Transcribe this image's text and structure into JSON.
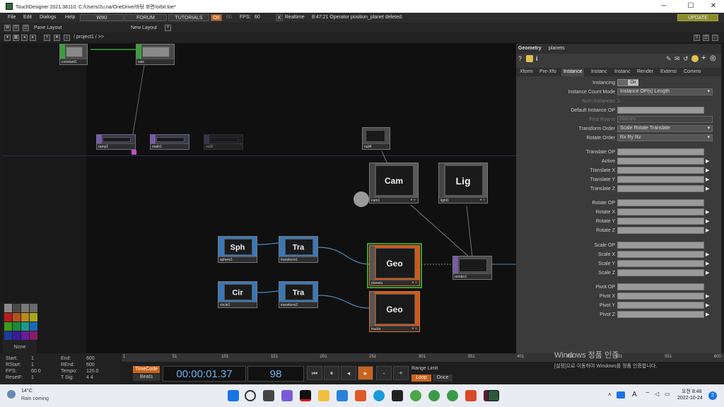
{
  "window": {
    "title": "TouchDesigner 2021.38110: C:/Users/2u.na/OneDrive/바탕 화면/orbit.toe*",
    "minimize": "─",
    "maximize": "☐",
    "close": "✕"
  },
  "menu": {
    "items": [
      "File",
      "Edit",
      "Dialogs",
      "Help"
    ],
    "wiki": "WIKI",
    "forum": "FORUM",
    "tutorials": "TUTORIALS",
    "oii": "OII",
    "fps_target": "60",
    "fps_label": "FPS:",
    "fps_value": "60",
    "x": "X",
    "realtime": "Realtime",
    "message": "8:47:21 Operator position_planet deleted.",
    "update": "UPDATE"
  },
  "layout": {
    "pane_layout": "Pane Layout",
    "new_layout": "New Layout",
    "plus": "+"
  },
  "path": {
    "text": "/ project1 / >>",
    "zero": "0"
  },
  "operators": {
    "constant1": "constant1",
    "vals": "vals",
    "ramp1": "ramp1",
    "math1": "math1",
    "null2": "null2",
    "null4": "null4",
    "cam": {
      "label": "Cam",
      "name": "cam1"
    },
    "light": {
      "label": "Lig",
      "name": "light1"
    },
    "sphere": {
      "label": "Sph",
      "name": "sphere1"
    },
    "tra1": {
      "label": "Tra",
      "name": "transform1"
    },
    "circle": {
      "label": "Cir",
      "name": "circle1"
    },
    "tra2": {
      "label": "Tra",
      "name": "transform2"
    },
    "geo1": {
      "label": "Geo",
      "name": "planets"
    },
    "geo2": {
      "label": "Geo",
      "name": "tracks"
    },
    "render": {
      "name": "render1"
    }
  },
  "palette": {
    "none": "None",
    "colors": [
      "#8a8a8a",
      "#4a4a4a",
      "#7a7a7a",
      "#6a6a6a",
      "#b81b1b",
      "#b5521b",
      "#b88a1b",
      "#a8a81b",
      "#3b9a1b",
      "#1b8a3b",
      "#1b9a8a",
      "#1b6ab8",
      "#1b3b9a",
      "#3b1b9a",
      "#6a1b9a",
      "#8a1b6a"
    ]
  },
  "params": {
    "type": "Geometry",
    "name": "planets",
    "tabs": [
      "Xform",
      "Pre-Xfo",
      "Instance",
      "Instanc",
      "Instanc",
      "Render",
      "Extensi",
      "Commo"
    ],
    "instancing_label": "Instancing",
    "instancing_value": "On",
    "count_mode_label": "Instance Count Mode",
    "count_mode_value": "Instance OP(s) Length",
    "num_instances_label": "Num Instances",
    "num_instances_value": "1",
    "default_op_label": "Default Instance OP",
    "first_row_label": "First Row is",
    "first_row_value": "Names",
    "transform_order_label": "Transform Order",
    "transform_order_value": "Scale Rotate Translate",
    "rotate_order_label": "Rotate Order",
    "rotate_order_value": "Rx Ry Rz",
    "translate": [
      "Translate OP",
      "Active",
      "Translate X",
      "Translate Y",
      "Translate Z"
    ],
    "rotate": [
      "Rotate OP",
      "Rotate X",
      "Rotate Y",
      "Rotate Z"
    ],
    "scale": [
      "Scale OP",
      "Scale X",
      "Scale Y",
      "Scale Z"
    ],
    "pivot": [
      "Pivot OP",
      "Pivot X",
      "Pivot Y",
      "Pivot Z"
    ]
  },
  "timeline": {
    "start_label": "Start:",
    "start": "1",
    "rstart_label": "RStart:",
    "rstart": "1",
    "fps_label": "FPS:",
    "fps": "60.0",
    "resetf_label": "ResetF:",
    "resetf": "1",
    "end_label": "End:",
    "end": "600",
    "rend_label": "REnd:",
    "rend": "600",
    "tempo_label": "Tempo:",
    "tempo": "120.0",
    "tsig_label": "T Sig:",
    "tsig": "4    4",
    "ticks": [
      "1",
      "51",
      "101",
      "151",
      "201",
      "251",
      "301",
      "351",
      "401",
      "451",
      "501",
      "551",
      "600"
    ],
    "timecode_label": "TimeCode",
    "beats_label": "Beats",
    "timecode": "00:00:01.37",
    "frame": "98",
    "range_limit": "Range Limit",
    "loop": "Loop",
    "once": "Once",
    "minus": "-",
    "plus": "+"
  },
  "watermark": {
    "line1": "Windows 정품 인증",
    "line2": "[설정]으로 이동하여 Windows를 정품 인증합니다."
  },
  "taskbar": {
    "temp": "14°C",
    "weather": "Rain coming",
    "time": "오전 8:48",
    "date": "2022-10-24",
    "lang": "A",
    "badge": "2"
  }
}
